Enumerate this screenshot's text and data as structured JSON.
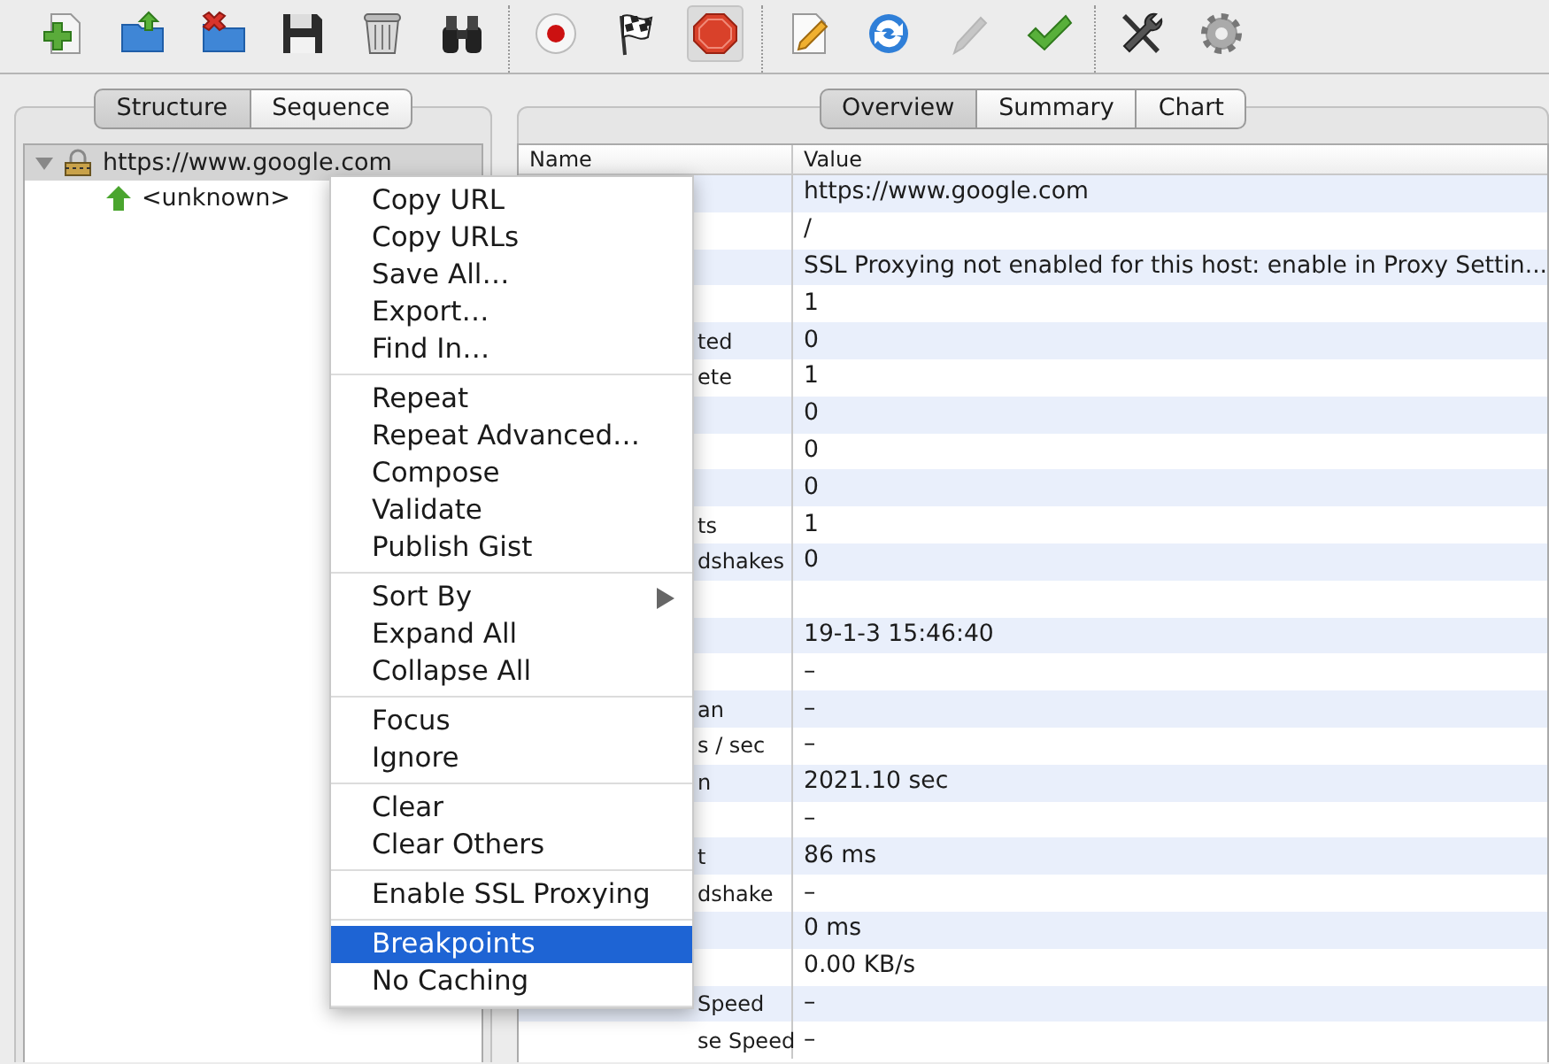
{
  "toolbar": {
    "groups": [
      [
        {
          "pressed": false,
          "disabled": false
        },
        {
          "pressed": false,
          "disabled": false
        },
        {
          "pressed": false,
          "disabled": false
        },
        {
          "pressed": false,
          "disabled": false
        },
        {
          "pressed": false,
          "disabled": false
        },
        {
          "pressed": false,
          "disabled": false
        }
      ],
      [
        {
          "pressed": false,
          "disabled": false
        },
        {
          "pressed": false,
          "disabled": false
        },
        {
          "pressed": true,
          "disabled": false
        }
      ],
      [
        {
          "pressed": false,
          "disabled": false
        },
        {
          "pressed": false,
          "disabled": false
        },
        {
          "pressed": false,
          "disabled": true
        },
        {
          "pressed": false,
          "disabled": false
        }
      ],
      [
        {
          "pressed": false,
          "disabled": false
        },
        {
          "pressed": false,
          "disabled": false
        }
      ]
    ]
  },
  "left_tabs": [
    {
      "label": "Structure",
      "selected": true
    },
    {
      "label": "Sequence",
      "selected": false
    }
  ],
  "tree": [
    {
      "label": "https://www.google.com",
      "expanded": true,
      "selected": true,
      "children": [
        {
          "label": "<unknown>"
        }
      ]
    }
  ],
  "right_tabs": [
    {
      "label": "Overview",
      "selected": true
    },
    {
      "label": "Summary",
      "selected": false
    },
    {
      "label": "Chart",
      "selected": false
    }
  ],
  "table": {
    "columns": [
      "Name",
      "Value"
    ],
    "rows": [
      {
        "value": "https://www.google.com"
      },
      {
        "value": "/"
      },
      {
        "value": "SSL Proxying not enabled for this host: enable in Proxy Settin..."
      },
      {
        "value": "1"
      },
      {
        "name": "ted",
        "value": "0"
      },
      {
        "name": "ete",
        "value": "1"
      },
      {
        "value": "0"
      },
      {
        "value": "0"
      },
      {
        "value": "0"
      },
      {
        "name": "ts",
        "value": "1"
      },
      {
        "name": "dshakes",
        "value": "0"
      },
      {},
      {
        "value": "19-1-3 15:46:40"
      },
      {
        "value": "–"
      },
      {
        "name": "an",
        "value": "–"
      },
      {
        "name": "s / sec",
        "value": "–"
      },
      {
        "name": "n",
        "value": "2021.10 sec"
      },
      {
        "value": "–"
      },
      {
        "name": "t",
        "value": "86 ms"
      },
      {
        "name": "dshake",
        "value": "–"
      },
      {
        "value": "0 ms"
      },
      {
        "value": "0.00 KB/s"
      },
      {
        "name": "Speed",
        "value": "–"
      },
      {
        "name": "se Speed",
        "value": "–"
      }
    ]
  },
  "context_menu": {
    "groups": [
      [
        {
          "label": "Copy URL",
          "kind": "action",
          "selected": false
        },
        {
          "label": "Copy URLs",
          "kind": "action",
          "selected": false
        },
        {
          "label": "Save All…",
          "kind": "action",
          "selected": false
        },
        {
          "label": "Export…",
          "kind": "action",
          "selected": false
        },
        {
          "label": "Find In…",
          "kind": "action",
          "selected": false
        }
      ],
      [
        {
          "label": "Repeat",
          "kind": "action",
          "selected": false
        },
        {
          "label": "Repeat Advanced…",
          "kind": "action",
          "selected": false
        },
        {
          "label": "Compose",
          "kind": "action",
          "selected": false
        },
        {
          "label": "Validate",
          "kind": "action",
          "selected": false
        },
        {
          "label": "Publish Gist",
          "kind": "action",
          "selected": false
        }
      ],
      [
        {
          "label": "Sort By",
          "kind": "submenu",
          "selected": false
        },
        {
          "label": "Expand All",
          "kind": "action",
          "selected": false
        },
        {
          "label": "Collapse All",
          "kind": "action",
          "selected": false
        }
      ],
      [
        {
          "label": "Focus",
          "kind": "action",
          "selected": false
        },
        {
          "label": "Ignore",
          "kind": "action",
          "selected": false
        }
      ],
      [
        {
          "label": "Clear",
          "kind": "action",
          "selected": false
        },
        {
          "label": "Clear Others",
          "kind": "action",
          "selected": false
        }
      ],
      [
        {
          "label": "Enable SSL Proxying",
          "kind": "action",
          "selected": false
        }
      ],
      [
        {
          "label": "Breakpoints",
          "kind": "action",
          "selected": true
        },
        {
          "label": "No Caching",
          "kind": "action",
          "selected": false
        }
      ]
    ]
  }
}
